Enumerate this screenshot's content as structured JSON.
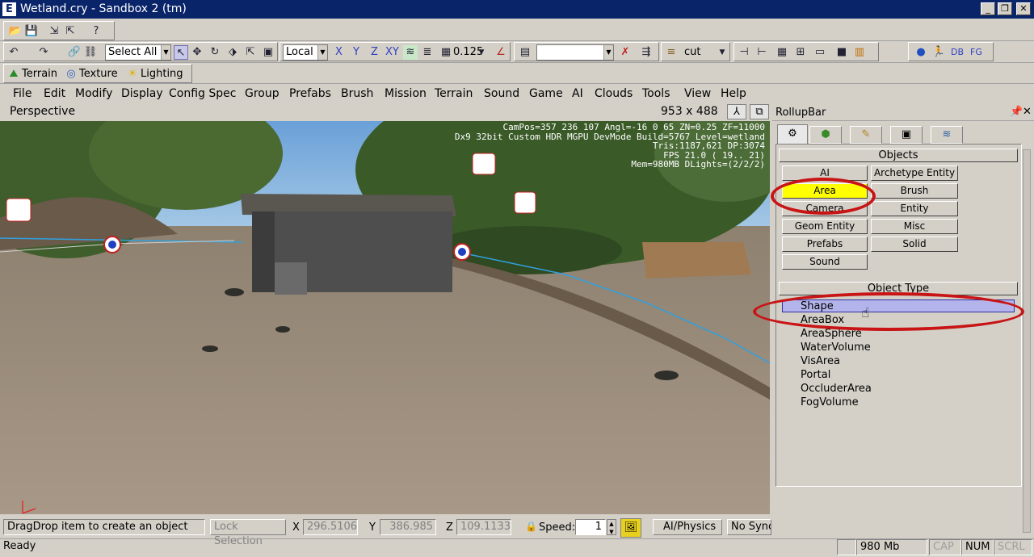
{
  "window": {
    "title": "Wetland.cry - Sandbox 2 (tm)",
    "app_icon": "E"
  },
  "toolbar1": {
    "select_filter": "Select All",
    "coord_system": "Local",
    "axes": [
      "X",
      "Y",
      "Z",
      "XY"
    ],
    "grid_size": "0.125",
    "layer_combo": "",
    "layer_name": "cut",
    "db_label": "DB",
    "fg_label": "FG"
  },
  "toolbar2": {
    "terrain": "Terrain",
    "texture": "Texture",
    "lighting": "Lighting"
  },
  "menu": [
    "File",
    "Edit",
    "Modify",
    "Display",
    "Config Spec",
    "Group",
    "Prefabs",
    "Brush",
    "Mission",
    "Terrain",
    "Sound",
    "Game",
    "AI",
    "Clouds",
    "Tools",
    "View",
    "Help"
  ],
  "viewport": {
    "name": "Perspective",
    "resolution": "953 x 488",
    "hud": [
      "CamPos=357 236 107 Angl=-16  0  65 ZN=0.25 ZF=11000",
      "Dx9 32bit Custom HDR MGPU DevMode Build=5767 Level=wetland",
      "Tris:1187,621  DP:3074",
      "FPS  21.0 ( 19.. 21)",
      "Mem=980MB DLights=(2/2/2)"
    ]
  },
  "rollup": {
    "title": "RollupBar",
    "objects_header": "Objects",
    "object_buttons": [
      "AI",
      "Archetype Entity",
      "Area",
      "Brush",
      "Camera",
      "Entity",
      "Geom Entity",
      "Misc",
      "Prefabs",
      "Solid",
      "Sound"
    ],
    "selected_object": "Area",
    "object_type_header": "Object Type",
    "object_types": [
      "Shape",
      "AreaBox",
      "AreaSphere",
      "WaterVolume",
      "VisArea",
      "Portal",
      "OccluderArea",
      "FogVolume"
    ],
    "selected_type": "Shape"
  },
  "status": {
    "hint": "DragDrop item to create an object",
    "lock_selection": "Lock Selection",
    "x_label": "X",
    "x": "296.5106",
    "y_label": "Y",
    "y": "386.985",
    "z_label": "Z",
    "z": "109.1133",
    "speed_label": "Speed:",
    "speed": "1",
    "ai_physics": "AI/Physics",
    "no_sync": "No Sync",
    "ready": "Ready",
    "memory": "980 Mb",
    "cap": "CAP",
    "num": "NUM",
    "scrl": "SCRL"
  },
  "colors": {
    "title_bg": "#0a246a",
    "selected_button": "#ffff00",
    "selected_row": "#b4b4ec",
    "annotation": "#c81414"
  }
}
